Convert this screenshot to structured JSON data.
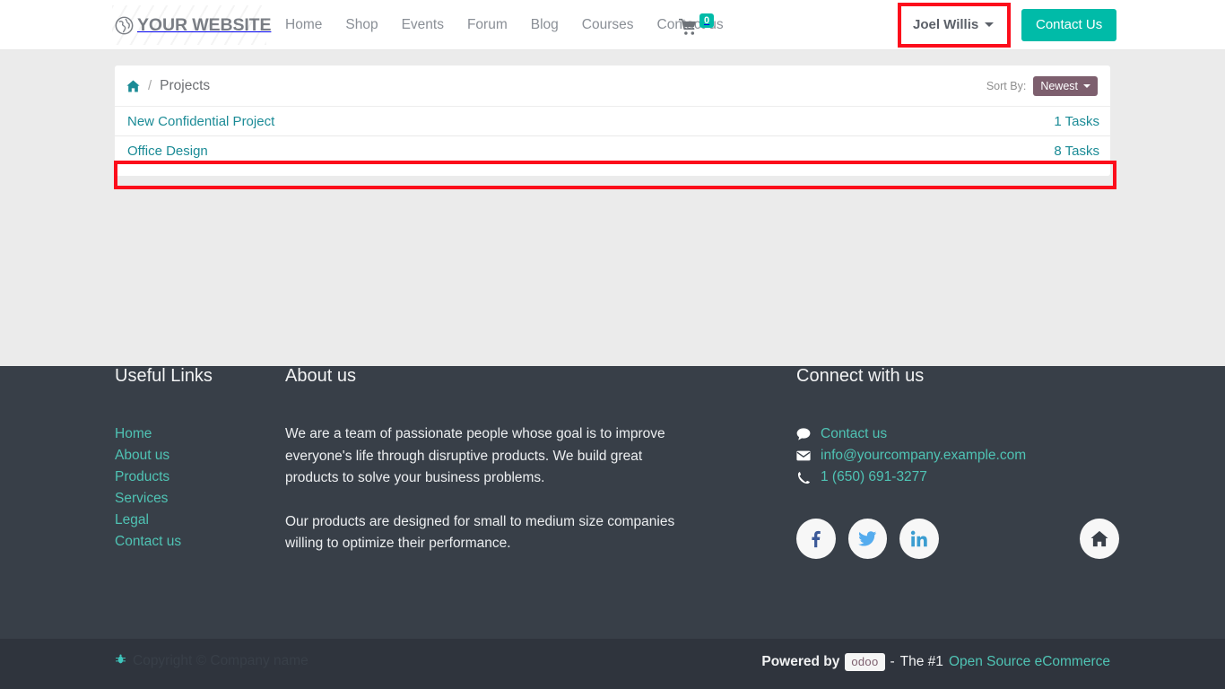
{
  "header": {
    "logo_text": "YOUR WEBSITE",
    "logo_icon": "globe-icon",
    "nav": [
      {
        "label": "Home"
      },
      {
        "label": "Shop"
      },
      {
        "label": "Events"
      },
      {
        "label": "Forum"
      },
      {
        "label": "Blog"
      },
      {
        "label": "Courses"
      },
      {
        "label": "Contact us"
      }
    ],
    "cart": {
      "icon": "shopping-cart-icon",
      "count": "0"
    },
    "user_menu": {
      "label": "Joel Willis",
      "icon": "chevron-down-icon"
    },
    "contact_button": "Contact Us"
  },
  "breadcrumb": {
    "home_icon": "home-icon",
    "separator": "/",
    "current": "Projects"
  },
  "sort": {
    "label": "Sort By:",
    "selected": "Newest",
    "options": [
      "Newest"
    ]
  },
  "projects": [
    {
      "name": "New Confidential Project",
      "tasks": "1 Tasks"
    },
    {
      "name": "Office Design",
      "tasks": "8 Tasks"
    }
  ],
  "footer": {
    "useful_links": {
      "title": "Useful Links",
      "items": [
        {
          "label": "Home"
        },
        {
          "label": "About us"
        },
        {
          "label": "Products"
        },
        {
          "label": "Services"
        },
        {
          "label": "Legal"
        },
        {
          "label": "Contact us"
        }
      ]
    },
    "about": {
      "title": "About us",
      "paragraph1": "We are a team of passionate people whose goal is to improve everyone's life through disruptive products. We build great products to solve your business problems.",
      "paragraph2": "Our products are designed for small to medium size companies willing to optimize their performance."
    },
    "connect": {
      "title": "Connect with us",
      "contact_us": "Contact us",
      "email": "info@yourcompany.example.com",
      "phone": "1 (650) 691-3277",
      "socials": [
        {
          "name": "facebook",
          "glyph": "f"
        },
        {
          "name": "twitter",
          "glyph": "t"
        },
        {
          "name": "linkedin",
          "glyph": "in"
        },
        {
          "name": "home",
          "glyph": "home"
        }
      ]
    }
  },
  "copyright": {
    "bug_icon": "bug-icon",
    "text": "Copyright © Company name",
    "powered_by": "Powered by",
    "brand": "odoo",
    "dash": "-",
    "the_number_one": "The #1",
    "link": "Open Source eCommerce"
  },
  "colors": {
    "accent_teal": "#00bba8",
    "link_teal": "#4fc3b4",
    "project_link": "#1b8b96",
    "footer_bg": "#383f48",
    "copybar_bg": "#2f343d",
    "sort_btn": "#7d5f6e",
    "highlight_red": "#fc0d1b",
    "page_bg": "#ebebeb"
  }
}
